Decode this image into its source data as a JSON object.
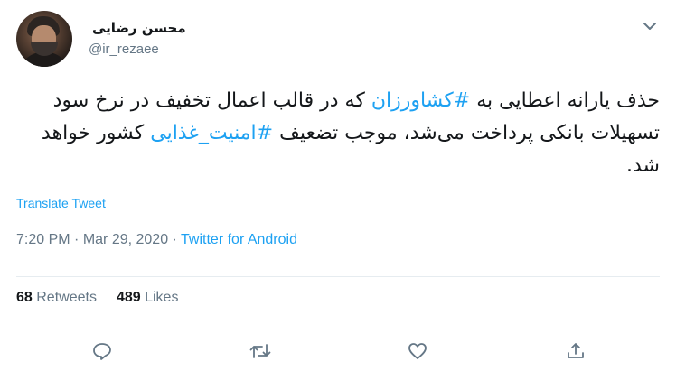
{
  "author": {
    "name": "محسن رضایی",
    "handle": "@ir_rezaee"
  },
  "tweet": {
    "part1": "حذف یارانه اعطایی به ",
    "hashtag1": "#کشاورزان",
    "part2": " که در قالب اعمال تخفیف در نرخ سود تسهیلات بانکی پرداخت می‌شد، موجب تضعیف ",
    "hashtag2": "#امنیت_غذایی",
    "part3": " کشور خواهد شد."
  },
  "translate_label": "Translate Tweet",
  "meta": {
    "time": "7:20 PM",
    "separator1": " · ",
    "date": "Mar 29, 2020",
    "separator2": " · ",
    "source": "Twitter for Android"
  },
  "stats": {
    "retweets_count": "68",
    "retweets_label": " Retweets",
    "likes_count": "489",
    "likes_label": " Likes"
  },
  "colors": {
    "accent": "#1da1f2",
    "muted": "#657786",
    "divider": "#e6ecf0"
  },
  "icons": [
    "chevron-down-icon",
    "reply-icon",
    "retweet-icon",
    "like-icon",
    "share-icon"
  ]
}
